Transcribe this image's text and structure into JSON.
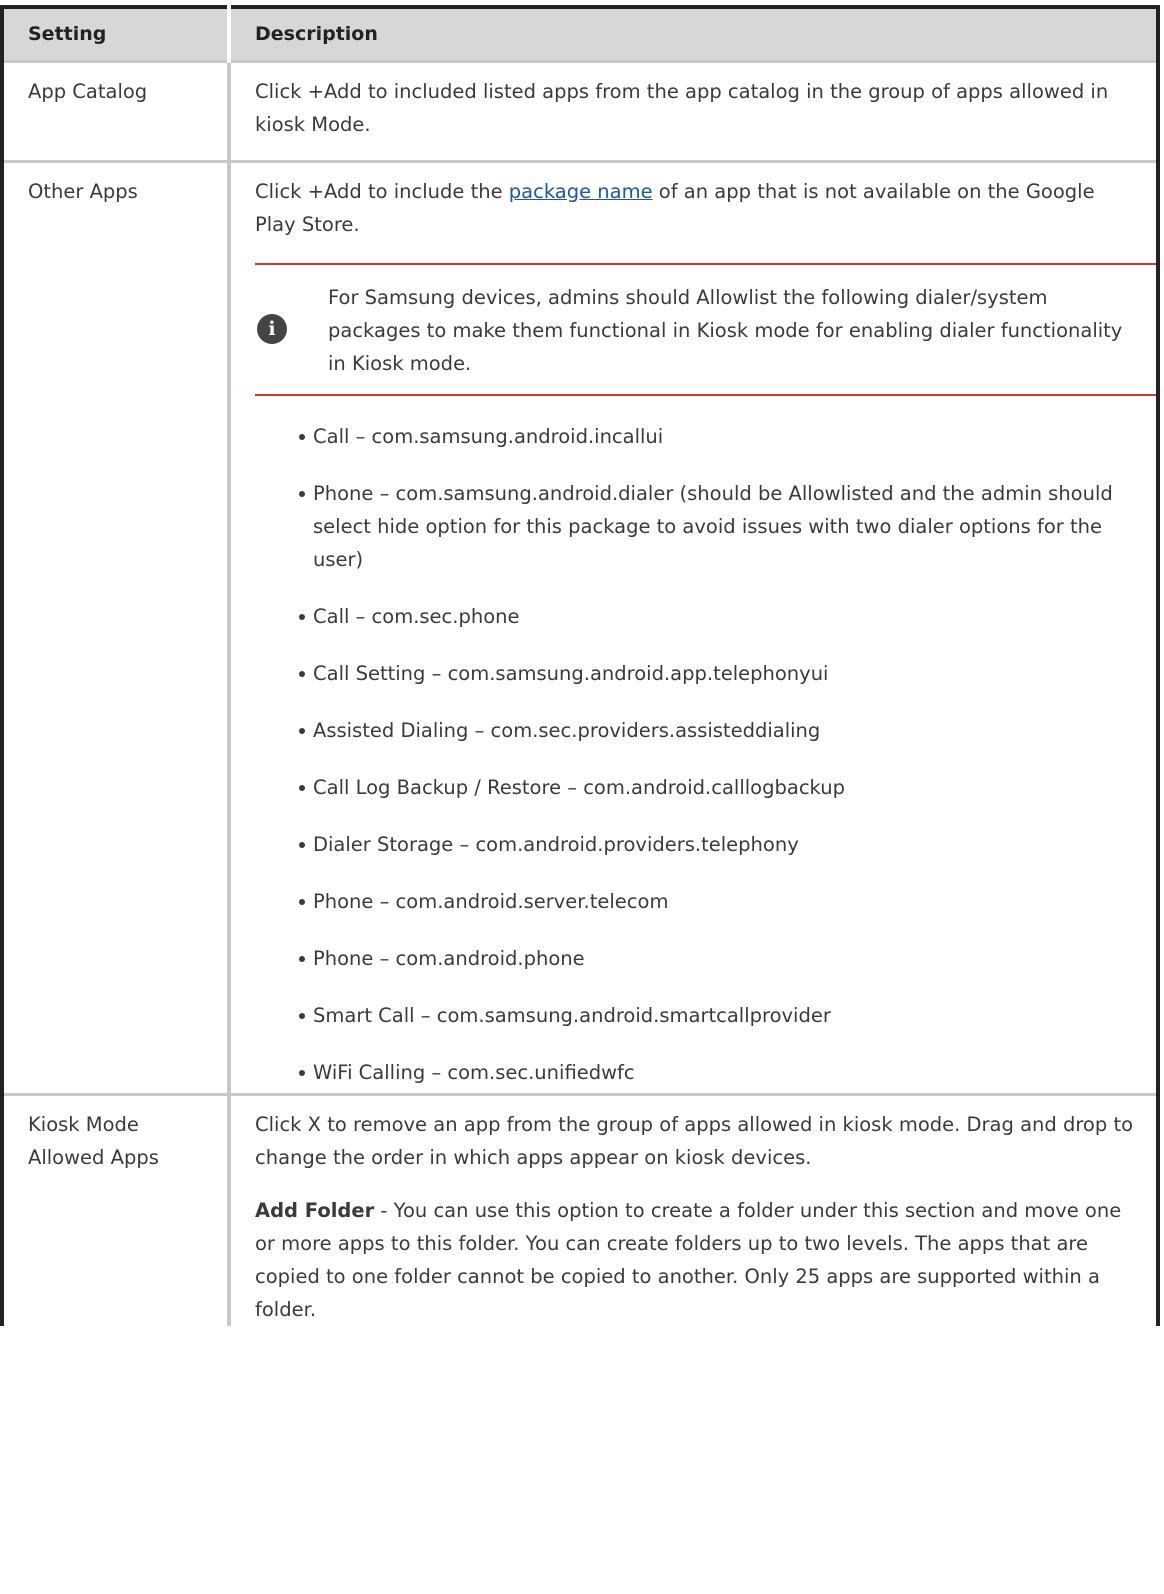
{
  "table": {
    "headers": [
      "Setting",
      "Description"
    ],
    "rows": {
      "app_catalog": {
        "setting": "App Catalog",
        "description": "Click +Add to included listed apps from the app catalog in the group of apps allowed in kiosk Mode."
      },
      "other_apps": {
        "setting": "Other Apps",
        "desc_before_link": "Click +Add to include the ",
        "link_text": "package name",
        "desc_after_link": " of an app that is not available on the Google Play Store.",
        "note": "For Samsung devices, admins should Allowlist the following dialer/system packages to make them functional in Kiosk mode for enabling dialer functionality in Kiosk mode.",
        "note_icon": "info-icon",
        "packages": [
          "Call – com.samsung.android.incallui",
          "Phone – com.samsung.android.dialer (should be Allowlisted and the admin should select hide option for this package to avoid issues with two dialer options for the user)",
          "Call – com.sec.phone",
          "Call Setting – com.samsung.android.app.telephonyui",
          "Assisted Dialing – com.sec.providers.assisteddialing",
          "Call Log Backup / Restore – com.android.calllogbackup",
          "Dialer Storage – com.android.providers.telephony",
          "Phone – com.android.server.telecom",
          "Phone – com.android.phone",
          "Smart Call – com.samsung.android.smartcallprovider",
          "WiFi Calling – com.sec.unifiedwfc"
        ]
      },
      "kiosk_allowed": {
        "setting": "Kiosk Mode Allowed Apps",
        "description": "Click X to remove an app from the group of apps allowed in kiosk mode. Drag and drop to change the order in which apps appear on kiosk devices.",
        "add_folder_label": "Add Folder",
        "add_folder_text": " - You can use this option to create a folder under this section and move one or more apps to this folder. You can create folders up to two levels. The apps that are copied to one folder cannot be copied to another. Only 25 apps are supported within a folder."
      }
    }
  },
  "colors": {
    "header_bg": "#d7d7d7",
    "link": "#1a57a8",
    "note_rule": "#d63232",
    "frame": "#222222"
  }
}
